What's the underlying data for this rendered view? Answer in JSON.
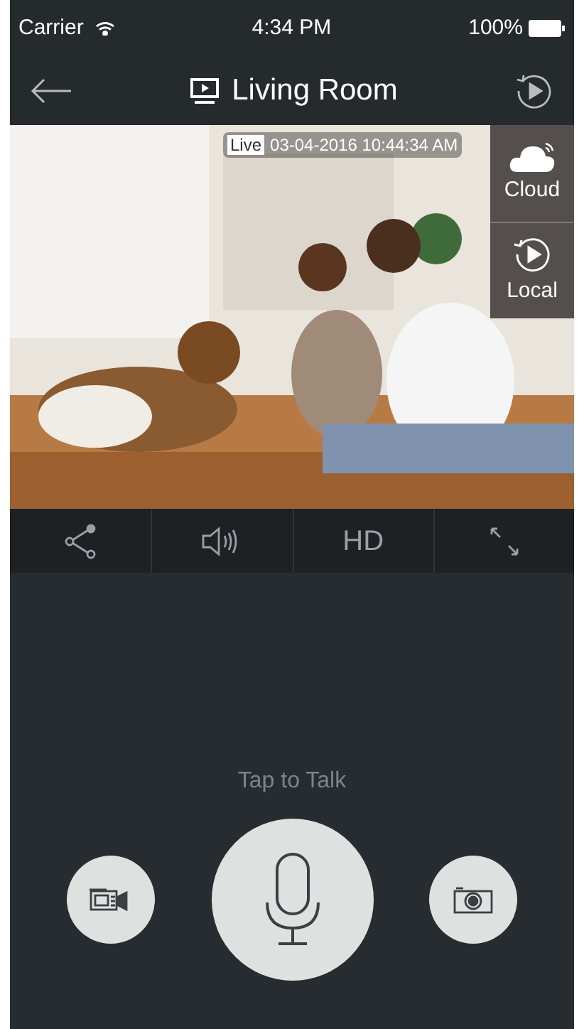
{
  "status_bar": {
    "carrier": "Carrier",
    "time": "4:34 PM",
    "battery": "100%"
  },
  "nav": {
    "title": "Living Room"
  },
  "video": {
    "live_badge": "Live",
    "timestamp": "03-04-2016 10:44:34 AM",
    "sources": [
      {
        "kind": "cloud",
        "label": "Cloud"
      },
      {
        "kind": "local",
        "label": "Local"
      }
    ]
  },
  "toolbar": [
    {
      "kind": "share"
    },
    {
      "kind": "sound"
    },
    {
      "kind": "text",
      "label": "HD"
    },
    {
      "kind": "fullscreen"
    }
  ],
  "talk": {
    "hint": "Tap to Talk"
  }
}
